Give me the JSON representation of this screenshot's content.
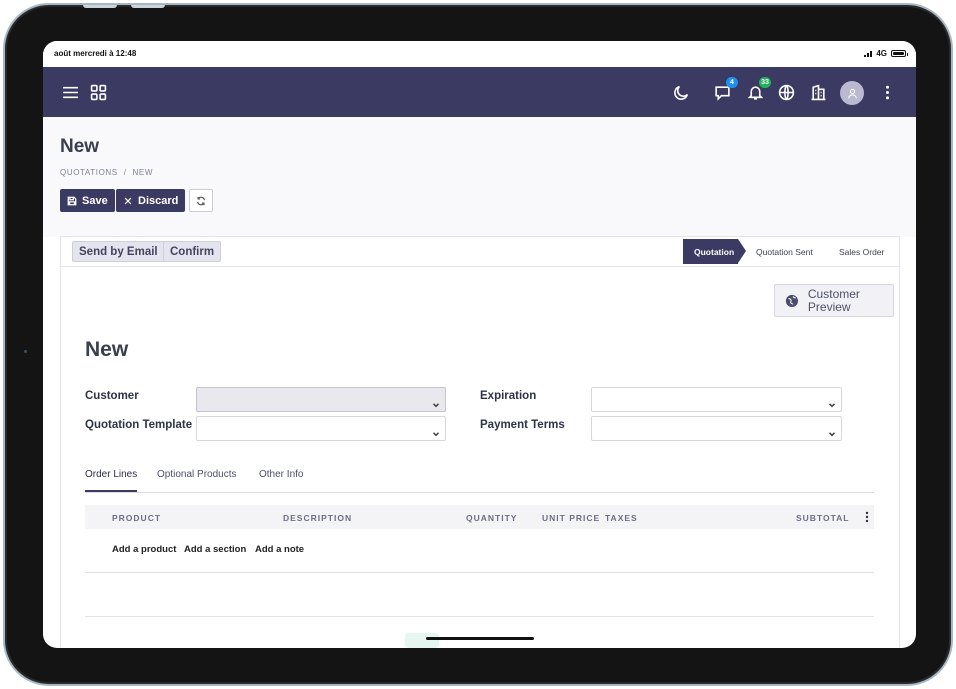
{
  "statusbar": {
    "time": "août mercredi à 12:48",
    "network": "4G"
  },
  "navbar": {
    "menu_icon": "hamburger-icon",
    "apps_icon": "apps-grid-icon",
    "chat_badge": "4",
    "activity_badge": "33"
  },
  "control": {
    "page_title": "New",
    "breadcrumb_parent": "QUOTATIONS",
    "breadcrumb_sep": "/",
    "breadcrumb_current": "NEW",
    "save_label": "Save",
    "discard_label": "Discard"
  },
  "form": {
    "buttons": {
      "send_email": "Send by Email",
      "confirm": "Confirm"
    },
    "stages": {
      "active": "Quotation",
      "sent": "Quotation Sent",
      "order": "Sales Order"
    },
    "customer_preview": "Customer Preview",
    "record_title": "New",
    "fields": {
      "customer": "Customer",
      "quotation_template": "Quotation Template",
      "expiration": "Expiration",
      "payment_terms": "Payment Terms"
    },
    "tabs": {
      "order_lines": "Order Lines",
      "optional_products": "Optional Products",
      "other_info": "Other Info"
    },
    "table_headers": {
      "product": "PRODUCT",
      "description": "DESCRIPTION",
      "quantity": "QUANTITY",
      "unit_price": "UNIT PRICE",
      "taxes": "TAXES",
      "subtotal": "SUBTOTAL"
    },
    "add_links": {
      "product": "Add a product",
      "section": "Add a section",
      "note": "Add a note"
    }
  },
  "colors": {
    "brand": "#3b3a63",
    "chat_badge": "#1f8ff0",
    "activity_badge": "#21b35c"
  }
}
